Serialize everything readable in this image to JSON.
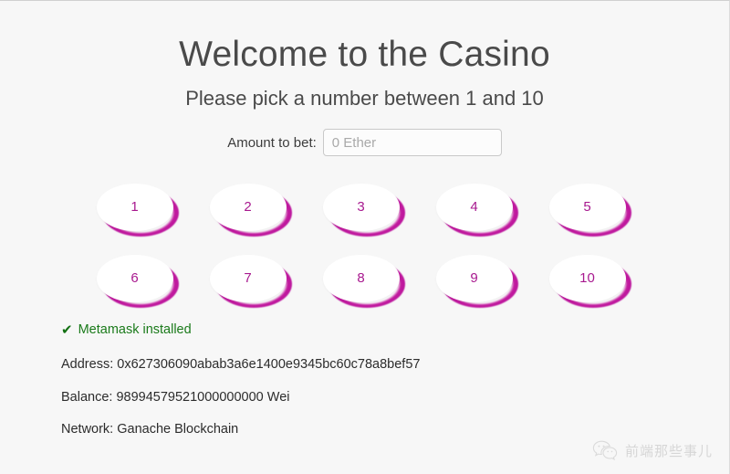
{
  "page": {
    "title": "Welcome to the Casino",
    "subtitle": "Please pick a number between 1 and 10",
    "background_color": "#f7f7f7",
    "heading_color": "#4a4a4a"
  },
  "bet": {
    "label": "Amount to bet:",
    "placeholder": "0 Ether",
    "value": ""
  },
  "numbers": {
    "accent_color": "#b5179e",
    "text_color": "#a8198f",
    "row1": [
      "1",
      "2",
      "3",
      "4",
      "5"
    ],
    "row2": [
      "6",
      "7",
      "8",
      "9",
      "10"
    ]
  },
  "status": {
    "metamask_icon": "check-icon",
    "metamask_text": "Metamask installed",
    "metamask_color": "#1a7a1a",
    "address": "Address: 0x627306090abab3a6e1400e9345bc60c78a8bef57",
    "balance": "Balance: 98994579521000000000 Wei",
    "network": "Network: Ganache Blockchain"
  },
  "watermark": {
    "icon": "wechat-icon",
    "text": "前端那些事儿"
  }
}
